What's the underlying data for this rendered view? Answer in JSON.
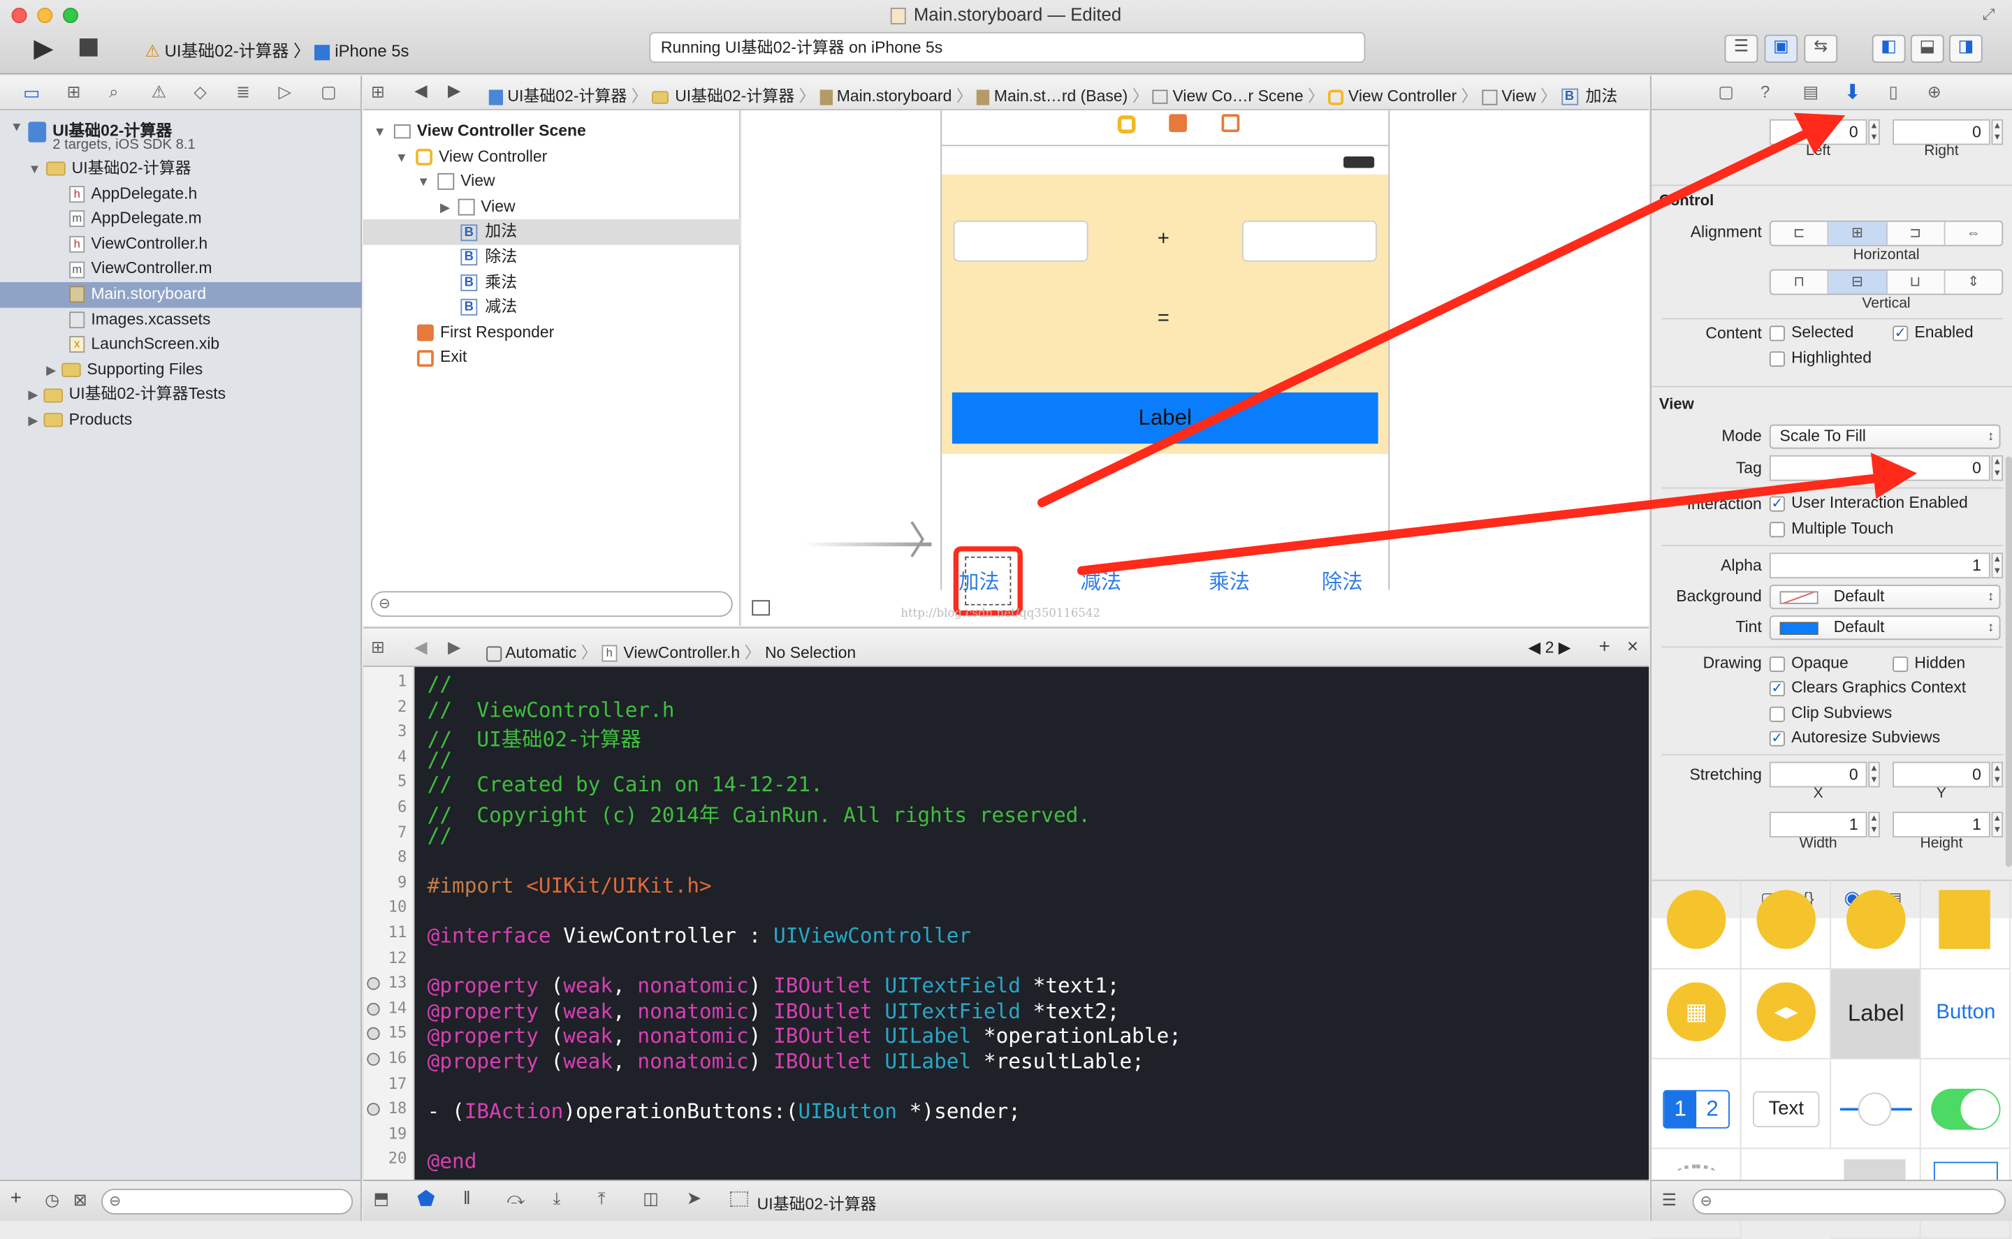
{
  "window": {
    "title": "Main.storyboard — Edited"
  },
  "toolbar": {
    "scheme": "UI基础02-计算器",
    "device": "iPhone 5s",
    "status": "Running UI基础02-计算器 on iPhone 5s"
  },
  "navigator": {
    "project": {
      "name": "UI基础02-计算器",
      "subtitle": "2 targets, iOS SDK 8.1"
    },
    "items": [
      {
        "label": "UI基础02-计算器",
        "type": "folder"
      },
      {
        "label": "AppDelegate.h",
        "type": "h"
      },
      {
        "label": "AppDelegate.m",
        "type": "m"
      },
      {
        "label": "ViewController.h",
        "type": "h"
      },
      {
        "label": "ViewController.m",
        "type": "m"
      },
      {
        "label": "Main.storyboard",
        "type": "storyboard"
      },
      {
        "label": "Images.xcassets",
        "type": "assets"
      },
      {
        "label": "LaunchScreen.xib",
        "type": "xib"
      },
      {
        "label": "Supporting Files",
        "type": "folder"
      },
      {
        "label": "UI基础02-计算器Tests",
        "type": "folder"
      },
      {
        "label": "Products",
        "type": "folder"
      }
    ]
  },
  "jumpbar": {
    "crumbs": [
      "UI基础02-计算器",
      "UI基础02-计算器",
      "Main.storyboard",
      "Main.st…rd (Base)",
      "View Co…r Scene",
      "View Controller",
      "View",
      "加法"
    ]
  },
  "outline": {
    "scene": "View Controller Scene",
    "items": [
      "View Controller",
      "View",
      "View",
      "加法",
      "除法",
      "乘法",
      "减法",
      "First Responder",
      "Exit"
    ]
  },
  "canvas": {
    "plus": "+",
    "equals": "=",
    "label_text": "Label",
    "buttons": [
      "加法",
      "减法",
      "乘法",
      "除法"
    ],
    "watermark": "http://blog.csdn.net/qq350116542"
  },
  "assistant": {
    "mode": "Automatic",
    "file": "ViewController.h",
    "selection": "No Selection",
    "counter": "2"
  },
  "code": {
    "lines": [
      "//",
      "//  ViewController.h",
      "//  UI基础02-计算器",
      "//",
      "//  Created by Cain on 14-12-21.",
      "//  Copyright (c) 2014年 CainRun. All rights reserved.",
      "//",
      "",
      "#import <UIKit/UIKit.h>",
      "",
      "@interface ViewController : UIViewController",
      "",
      "@property (weak, nonatomic) IBOutlet UITextField *text1;",
      "@property (weak, nonatomic) IBOutlet UITextField *text2;",
      "@property (weak, nonatomic) IBOutlet UILabel *operationLable;",
      "@property (weak, nonatomic) IBOutlet UILabel *resultLable;",
      "",
      "- (IBAction)operationButtons:(UIButton *)sender;",
      "",
      "@end"
    ]
  },
  "inspector": {
    "inset": {
      "left": "0",
      "right": "0",
      "left_label": "Left",
      "right_label": "Right"
    },
    "control": {
      "title": "Control",
      "alignment_label": "Alignment",
      "horizontal": "Horizontal",
      "vertical": "Vertical",
      "content_label": "Content",
      "selected": "Selected",
      "enabled": "Enabled",
      "highlighted": "Highlighted"
    },
    "view": {
      "title": "View",
      "mode_label": "Mode",
      "mode": "Scale To Fill",
      "tag_label": "Tag",
      "tag": "0",
      "interaction_label": "Interaction",
      "user_interaction": "User Interaction Enabled",
      "multiple_touch": "Multiple Touch",
      "alpha_label": "Alpha",
      "alpha": "1",
      "background_label": "Background",
      "background": "Default",
      "tint_label": "Tint",
      "tint": "Default",
      "drawing_label": "Drawing",
      "opaque": "Opaque",
      "hidden": "Hidden",
      "clears": "Clears Graphics Context",
      "clip": "Clip Subviews",
      "autoresize": "Autoresize Subviews",
      "stretching_label": "Stretching",
      "sx": "0",
      "sy": "0",
      "sw": "1",
      "sh": "1",
      "x_label": "X",
      "y_label": "Y",
      "w_label": "Width",
      "h_label": "Height"
    }
  },
  "library": {
    "label": "Label",
    "button": "Button",
    "seg1": "1",
    "seg2": "2",
    "text": "Text"
  },
  "debugbar": {
    "target": "UI基础02-计算器"
  },
  "colors": {
    "accent": "#0a84ff",
    "arrow": "#ff2a1a",
    "code_bg": "#1e2127"
  }
}
